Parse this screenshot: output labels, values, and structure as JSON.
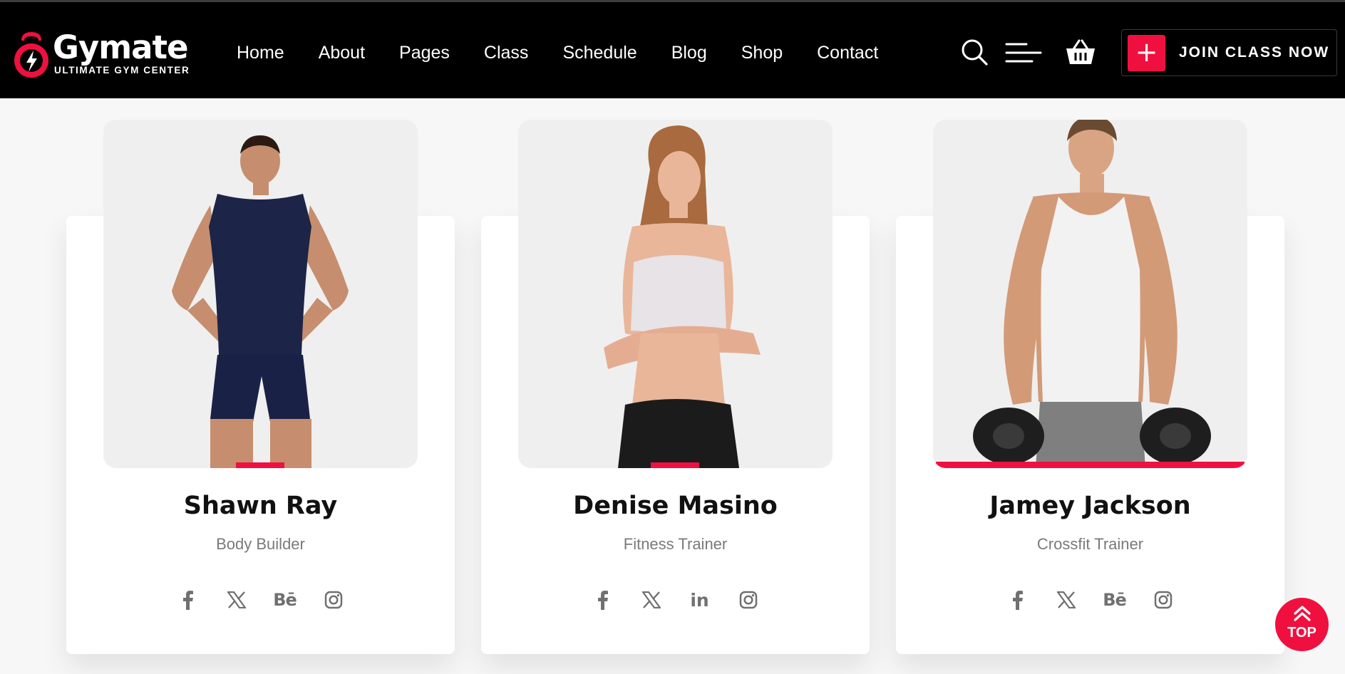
{
  "header": {
    "brand_name": "Gymate",
    "brand_tagline": "ULTIMATE GYM CENTER",
    "nav": [
      "Home",
      "About",
      "Pages",
      "Class",
      "Schedule",
      "Blog",
      "Shop",
      "Contact"
    ],
    "icons": [
      "search-icon",
      "menu-icon",
      "cart-icon"
    ],
    "cta_plus": "+",
    "cta_label": "JOIN CLASS NOW"
  },
  "trainers": [
    {
      "name": "Shawn Ray",
      "role": "Body Builder",
      "social": [
        "facebook-icon",
        "x-icon",
        "behance-icon",
        "instagram-icon"
      ],
      "behance_label": "Bē"
    },
    {
      "name": "Denise Masino",
      "role": "Fitness Trainer",
      "social": [
        "facebook-icon",
        "x-icon",
        "linkedin-icon",
        "instagram-icon"
      ],
      "linkedin_label": "in"
    },
    {
      "name": "Jamey Jackson",
      "role": "Crossfit Trainer",
      "social": [
        "facebook-icon",
        "x-icon",
        "behance-icon",
        "instagram-icon"
      ],
      "behance_label": "Bē"
    }
  ],
  "scroll_top": {
    "label": "TOP"
  },
  "colors": {
    "accent": "#f0103f",
    "header_bg": "#000000",
    "page_bg": "#f7f7f7",
    "photo_bg": "#efefef"
  }
}
